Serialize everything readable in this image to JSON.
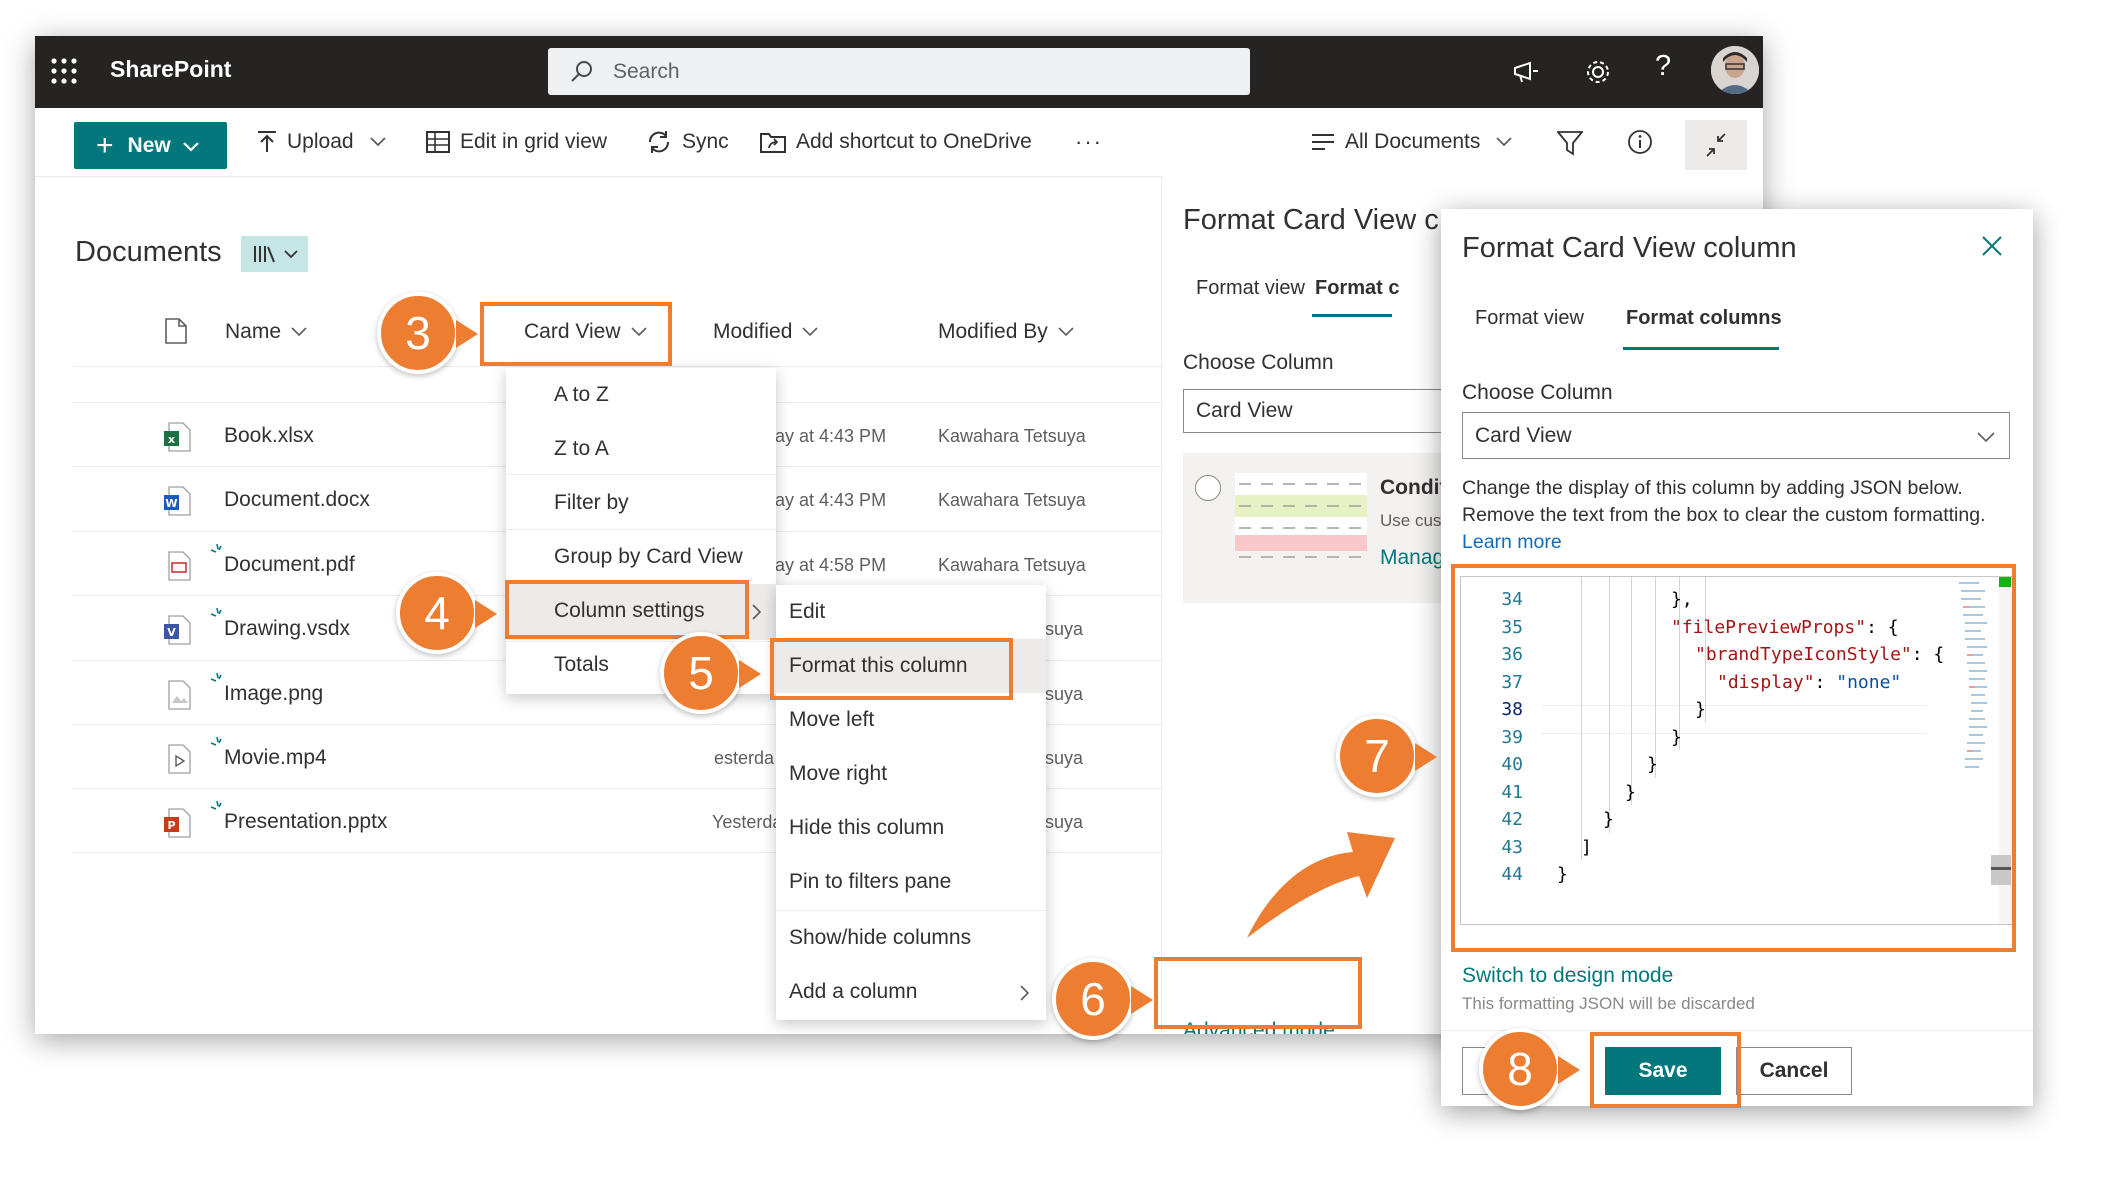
{
  "suite": {
    "grid_icon": "waffle-icon",
    "app_title": "SharePoint",
    "search_placeholder": "Search"
  },
  "toolbar": {
    "new_label": "New",
    "upload_label": "Upload",
    "grid_label": "Edit in grid view",
    "sync_label": "Sync",
    "shortcut_label": "Add shortcut to OneDrive",
    "more_label": "···",
    "view_label": "All Documents"
  },
  "library": {
    "title": "Documents",
    "columns": {
      "name": "Name",
      "card_view": "Card View",
      "modified": "Modified",
      "modified_by": "Modified By"
    },
    "files": [
      {
        "name": "Book.xlsx",
        "type": "excel",
        "modified": "ay at 4:43 PM",
        "modified_by": "Kawahara Tetsuya",
        "new": false
      },
      {
        "name": "Document.docx",
        "type": "word",
        "modified": "ay at 4:43 PM",
        "modified_by": "Kawahara Tetsuya",
        "new": false
      },
      {
        "name": "Document.pdf",
        "type": "pdf",
        "modified": "ay at 4:58 PM",
        "modified_by": "Kawahara Tetsuya",
        "new": true
      },
      {
        "name": "Drawing.vsdx",
        "type": "visio",
        "modified": "",
        "modified_by": "suya",
        "new": true
      },
      {
        "name": "Image.png",
        "type": "image",
        "modified": "",
        "modified_by": "suya",
        "new": true
      },
      {
        "name": "Movie.mp4",
        "type": "video",
        "modified": "esterda",
        "modified_by": "suya",
        "new": true
      },
      {
        "name": "Presentation.pptx",
        "type": "powerpoint",
        "modified": "Yesterda",
        "modified_by": "suya",
        "new": true
      }
    ]
  },
  "column_menu": {
    "items": [
      "A to Z",
      "Z to A",
      "Filter by",
      "Group by Card View",
      "Column settings",
      "Totals"
    ]
  },
  "settings_submenu": {
    "items": [
      "Edit",
      "Format this column",
      "Move left",
      "Move right",
      "Hide this column",
      "Pin to filters pane",
      "Show/hide columns",
      "Add a column"
    ]
  },
  "panel_back": {
    "title": "Format Card View c",
    "tabs": [
      "Format view",
      "Format c"
    ],
    "choose_label": "Choose Column",
    "select_value": "Card View",
    "condition_title": "Condit",
    "condition_desc": "Use cus",
    "manage_link": "Manag",
    "advanced_link": "Advanced mode"
  },
  "panel": {
    "title": "Format Card View column",
    "tabs": [
      "Format view",
      "Format columns"
    ],
    "choose_label": "Choose Column",
    "select_value": "Card View",
    "description": "Change the display of this column by adding JSON below. Remove the text from the box to clear the custom formatting.",
    "learn_more": "Learn more",
    "code_lines": [
      {
        "n": "34",
        "text": "},",
        "indent": 0
      },
      {
        "n": "35",
        "text": "\"filePreviewProps\": {",
        "indent": 0
      },
      {
        "n": "36",
        "text": "\"brandTypeIconStyle\": {",
        "indent": 1
      },
      {
        "n": "37",
        "text": "\"display\": \"none\"",
        "indent": 2
      },
      {
        "n": "38",
        "text": "}",
        "indent": 1
      },
      {
        "n": "39",
        "text": "}",
        "indent": 0
      },
      {
        "n": "40",
        "text": "}",
        "indent": -1
      },
      {
        "n": "41",
        "text": "}",
        "indent": -2
      },
      {
        "n": "42",
        "text": "}",
        "indent": -3
      },
      {
        "n": "43",
        "text": "]",
        "indent": -4
      },
      {
        "n": "44",
        "text": "}",
        "indent": -5
      }
    ],
    "switch_link": "Switch to design mode",
    "discard_note": "This formatting JSON will be discarded",
    "save_label": "Save",
    "cancel_label": "Cancel"
  },
  "steps": [
    "3",
    "4",
    "5",
    "6",
    "7",
    "8"
  ],
  "colors": {
    "accent": "#ed7d31",
    "brand": "#03787c",
    "suite_bg": "#252423",
    "link": "#0f6cbd"
  }
}
